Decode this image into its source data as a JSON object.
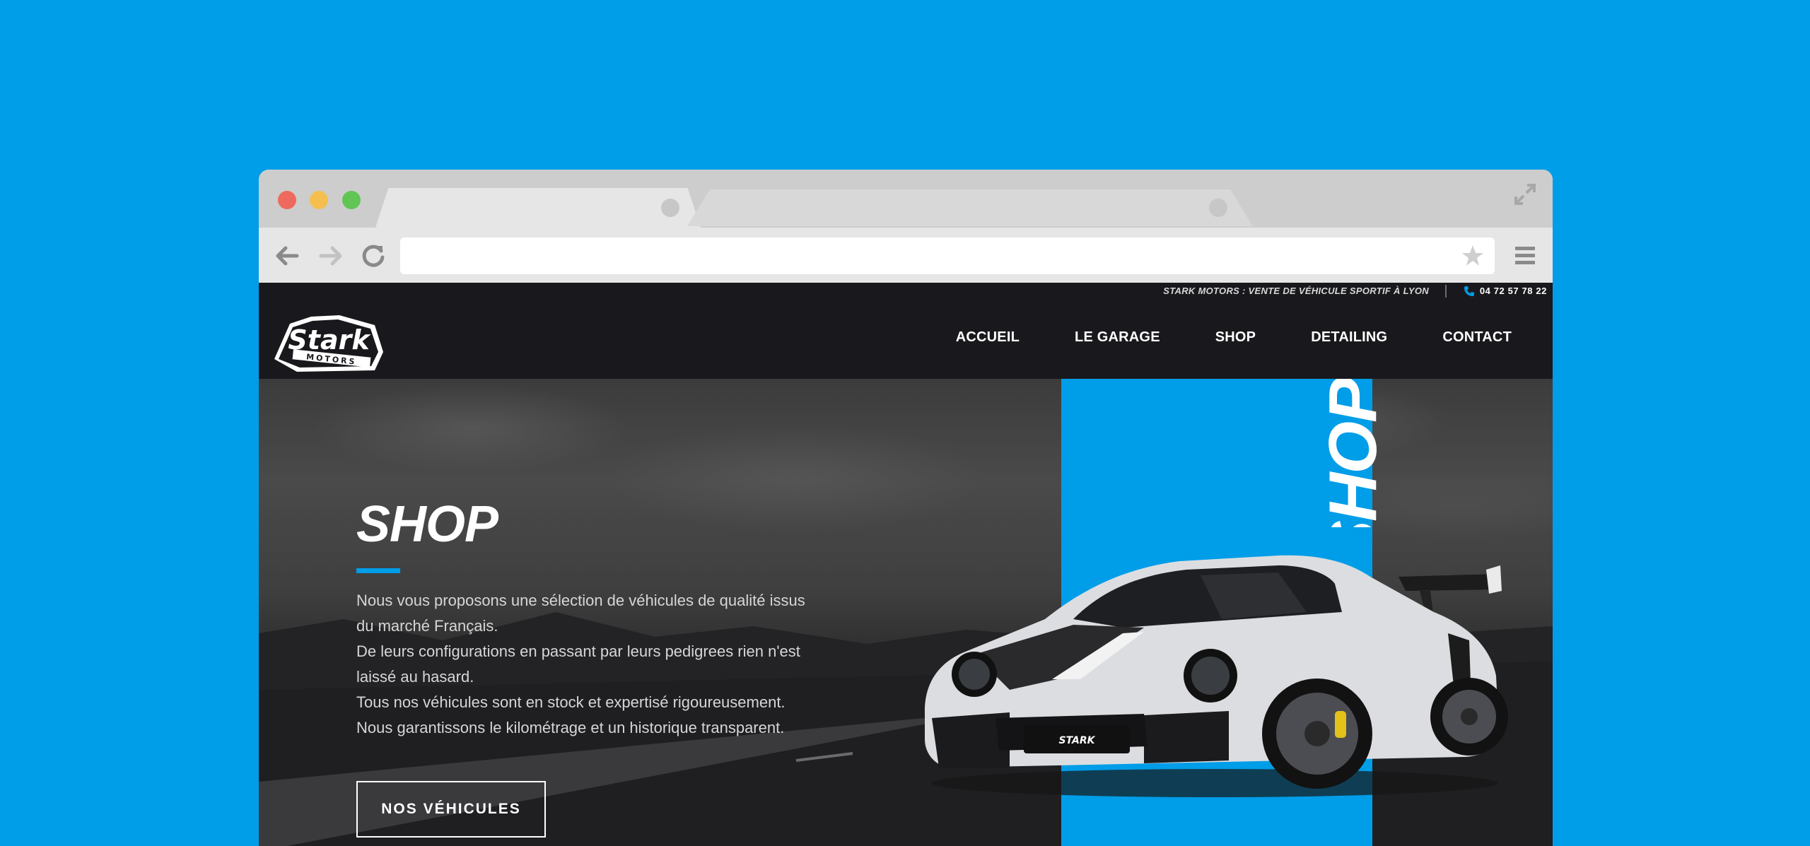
{
  "browser": {
    "address_value": ""
  },
  "site": {
    "topbar": {
      "tagline": "STARK MOTORS : VENTE DE VÉHICULE SPORTIF À LYON",
      "phone": "04 72 57 78 22"
    },
    "logo_text": "STARK MOTORS",
    "nav": [
      {
        "label": "ACCUEIL"
      },
      {
        "label": "LE GARAGE"
      },
      {
        "label": "SHOP"
      },
      {
        "label": "DETAILING"
      },
      {
        "label": "CONTACT"
      }
    ],
    "hero": {
      "title": "SHOP",
      "vertical_text": "SHOP",
      "paragraph_lines": [
        "Nous vous proposons une sélection de véhicules de qualité issus",
        "du marché Français.",
        "De leurs configurations en passant par leurs pedigrees rien n'est",
        "laissé au hasard.",
        "Tous nos véhicules sont en stock et expertisé rigoureusement.",
        "Nous garantissons le kilométrage et un historique transparent."
      ],
      "button_label": "NOS VÉHICULES",
      "car_plate_logo": "STARK"
    }
  },
  "colors": {
    "background": "#009de8",
    "accent": "#009de8",
    "header": "#19191d"
  },
  "icons": [
    "back-arrow-icon",
    "forward-arrow-icon",
    "reload-icon",
    "star-icon",
    "menu-icon",
    "expand-icon",
    "phone-icon"
  ]
}
